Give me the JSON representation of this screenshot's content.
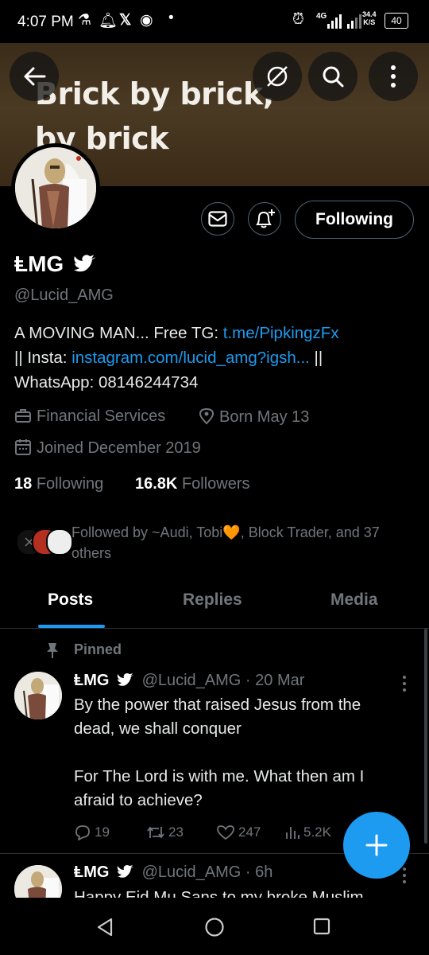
{
  "status_bar": {
    "time": "4:07 PM",
    "network": "4G",
    "speed_value": "34.4",
    "speed_unit": "K/S",
    "battery": "40"
  },
  "banner": {
    "line1": "Brick by brick,",
    "line2": "by brick"
  },
  "profile": {
    "name": "ⱠMG",
    "handle": "@Lucid_AMG",
    "bio_text1": "A MOVING MAN... Free TG: ",
    "bio_link1": "t.me/PipkingzFx",
    "bio_text2": "|| Insta: ",
    "bio_link2": "instagram.com/lucid_amg?igsh...",
    "bio_text3": " ||",
    "bio_text4": "WhatsApp: 08146244734",
    "category": "Financial Services",
    "born": "Born May 13",
    "joined": "Joined December 2019",
    "following_count": "18",
    "following_label": "Following",
    "followers_count": "16.8K",
    "followers_label": "Followers",
    "followed_by": "Followed by ~Audi, Tobi🧡, Block Trader, and 37 others"
  },
  "buttons": {
    "following": "Following"
  },
  "tabs": [
    "Posts",
    "Replies",
    "Media"
  ],
  "tweets": [
    {
      "pinned_label": "Pinned",
      "name": "ⱠMG",
      "handle": "@Lucid_AMG",
      "time": "· 20 Mar",
      "line1": "By the power that raised Jesus from the",
      "line2": "dead, we shall conquer",
      "line3": "For The Lord is with me. What then am I",
      "line4": "afraid to achieve?",
      "replies": "19",
      "reposts": "23",
      "likes": "247",
      "views": "5.2K"
    },
    {
      "name": "ⱠMG",
      "handle": "@Lucid_AMG",
      "time": "· 6h",
      "line1": "Happy Eid Mu Sans to my broke Muslim"
    }
  ],
  "colors": {
    "accent": "#1d9bf0",
    "muted": "#71767b",
    "background": "#000000"
  }
}
